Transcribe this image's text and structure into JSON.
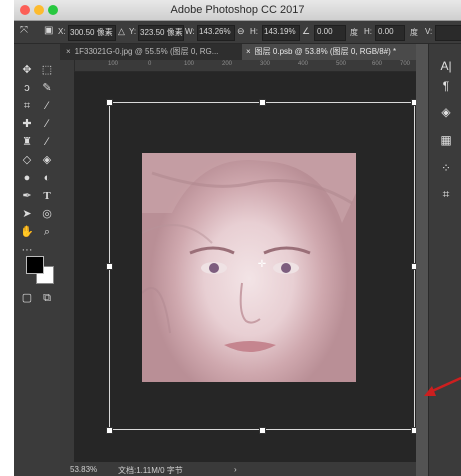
{
  "app": {
    "title": "Adobe Photoshop CC 2017"
  },
  "options_bar": {
    "x_label": "X:",
    "x_value": "300.50 像素",
    "y_label": "Y:",
    "y_value": "323.50 像素",
    "w_label": "W:",
    "w_value": "143.26%",
    "h_label": "H:",
    "h_value": "143.19%",
    "angle_value": "0.00",
    "angle_unit": "度",
    "hskew_label": "H:",
    "hskew_value": "0.00",
    "hskew_unit": "度",
    "vskew_label": "V:"
  },
  "tabs": [
    {
      "label": "1F33021G-0.jpg @ 55.5% (图层 0, RG..."
    },
    {
      "label": "图层 0.psb @ 53.8% (图层 0, RGB/8#) *"
    }
  ],
  "ruler": {
    "ticks": [
      "100",
      "0",
      "100",
      "200",
      "300",
      "400",
      "500",
      "600",
      "700"
    ]
  },
  "status": {
    "zoom": "53.83%",
    "doc_info": "文档:1.11M/0 字节",
    "arrow": "›"
  },
  "colors": {
    "annotation_arrow": "#cc1f1f",
    "canvas_bg": "#262626",
    "ui_dark": "#3b3b3b"
  },
  "right_panel": {
    "icons": [
      "character-icon",
      "paragraph-icon",
      "layers-icon",
      "channels-icon",
      "swatches-icon",
      "crop-icon"
    ]
  }
}
